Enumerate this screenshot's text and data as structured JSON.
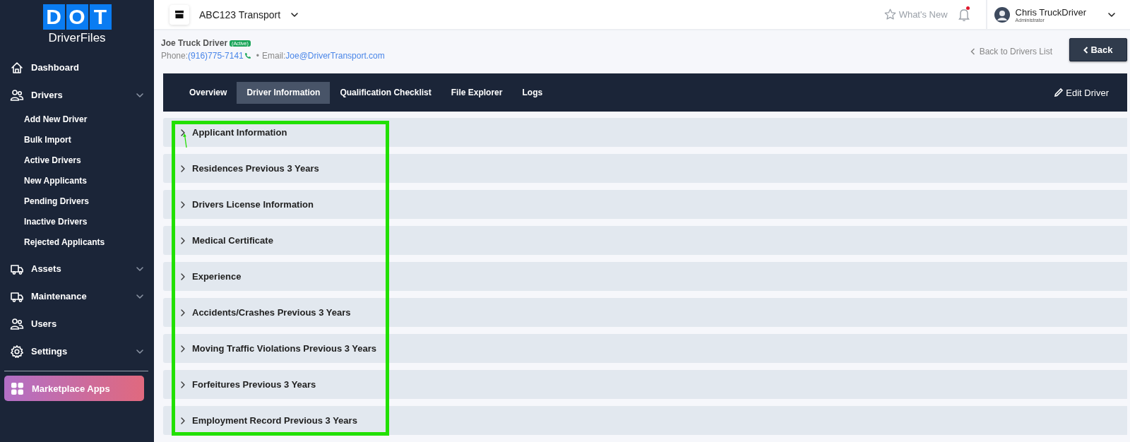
{
  "sidebar": {
    "logo": {
      "letters": [
        "D",
        "O",
        "T"
      ],
      "name": "DriverFiles"
    },
    "items": [
      {
        "label": "Dashboard",
        "kind": "link"
      },
      {
        "label": "Drivers",
        "kind": "group",
        "expanded": true,
        "children": [
          {
            "label": "Add New Driver"
          },
          {
            "label": "Bulk Import"
          },
          {
            "label": "Active Drivers"
          },
          {
            "label": "New Applicants"
          },
          {
            "label": "Pending Drivers"
          },
          {
            "label": "Inactive Drivers"
          },
          {
            "label": "Rejected Applicants"
          }
        ]
      },
      {
        "label": "Assets",
        "kind": "group"
      },
      {
        "label": "Maintenance",
        "kind": "group"
      },
      {
        "label": "Users",
        "kind": "link"
      },
      {
        "label": "Settings",
        "kind": "group"
      }
    ],
    "marketplace": {
      "label": "Marketplace Apps"
    }
  },
  "topbar": {
    "company": "ABC123 Transport",
    "whats_new": "What's New",
    "notifications": {
      "unread": true
    },
    "user": {
      "name": "Chris TruckDriver",
      "role": "Administrator"
    }
  },
  "driver": {
    "name": "Joe Truck Driver",
    "status": "(Active)",
    "phone_label": "Phone:",
    "phone": "(916)775-7141",
    "separator": "•",
    "email_label": "Email:",
    "email": "Joe@DriverTransport.com"
  },
  "back_link": "Back to Drivers List",
  "back_button": "Back",
  "tabs": [
    {
      "label": "Overview",
      "selected": false
    },
    {
      "label": "Driver Information",
      "selected": true
    },
    {
      "label": "Qualification Checklist",
      "selected": false
    },
    {
      "label": "File Explorer",
      "selected": false
    },
    {
      "label": "Logs",
      "selected": false
    }
  ],
  "edit_button": "Edit Driver",
  "sections": [
    {
      "title": "Applicant Information",
      "expanded": false
    },
    {
      "title": "Residences Previous 3 Years",
      "expanded": false
    },
    {
      "title": "Drivers License Information",
      "expanded": false
    },
    {
      "title": "Medical Certificate",
      "expanded": false
    },
    {
      "title": "Experience",
      "expanded": false
    },
    {
      "title": "Accidents/Crashes Previous 3 Years",
      "expanded": false
    },
    {
      "title": "Moving Traffic Violations Previous 3 Years",
      "expanded": false
    },
    {
      "title": "Forfeitures Previous 3 Years",
      "expanded": false
    },
    {
      "title": "Employment Record Previous 3 Years",
      "expanded": false
    }
  ]
}
